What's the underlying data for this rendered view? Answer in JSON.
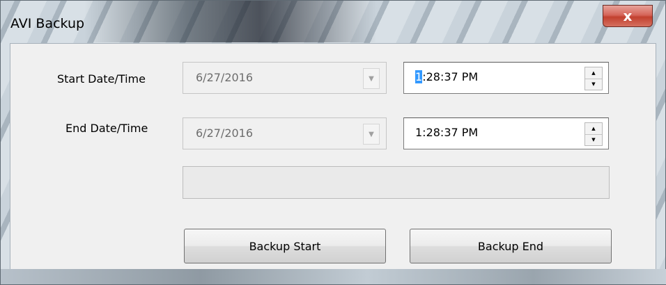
{
  "window": {
    "title": "AVI Backup",
    "close_glyph": "x"
  },
  "form": {
    "start": {
      "label": "Start Date/Time",
      "date": "6/27/2016",
      "time_first_digit": "1",
      "time_rest": ":28:37 PM"
    },
    "end": {
      "label": "End Date/Time",
      "date": "6/27/2016",
      "time": "1:28:37 PM"
    },
    "progress": 0
  },
  "buttons": {
    "backup_start": "Backup Start",
    "backup_end": "Backup End"
  },
  "icons": {
    "dropdown": "chevron-down-icon",
    "spin_up": "spin-up-icon",
    "spin_down": "spin-down-icon",
    "close": "close-icon"
  },
  "colors": {
    "selection": "#3399ff",
    "close_button": "#c2412f",
    "client_bg": "#f0f0f0"
  }
}
